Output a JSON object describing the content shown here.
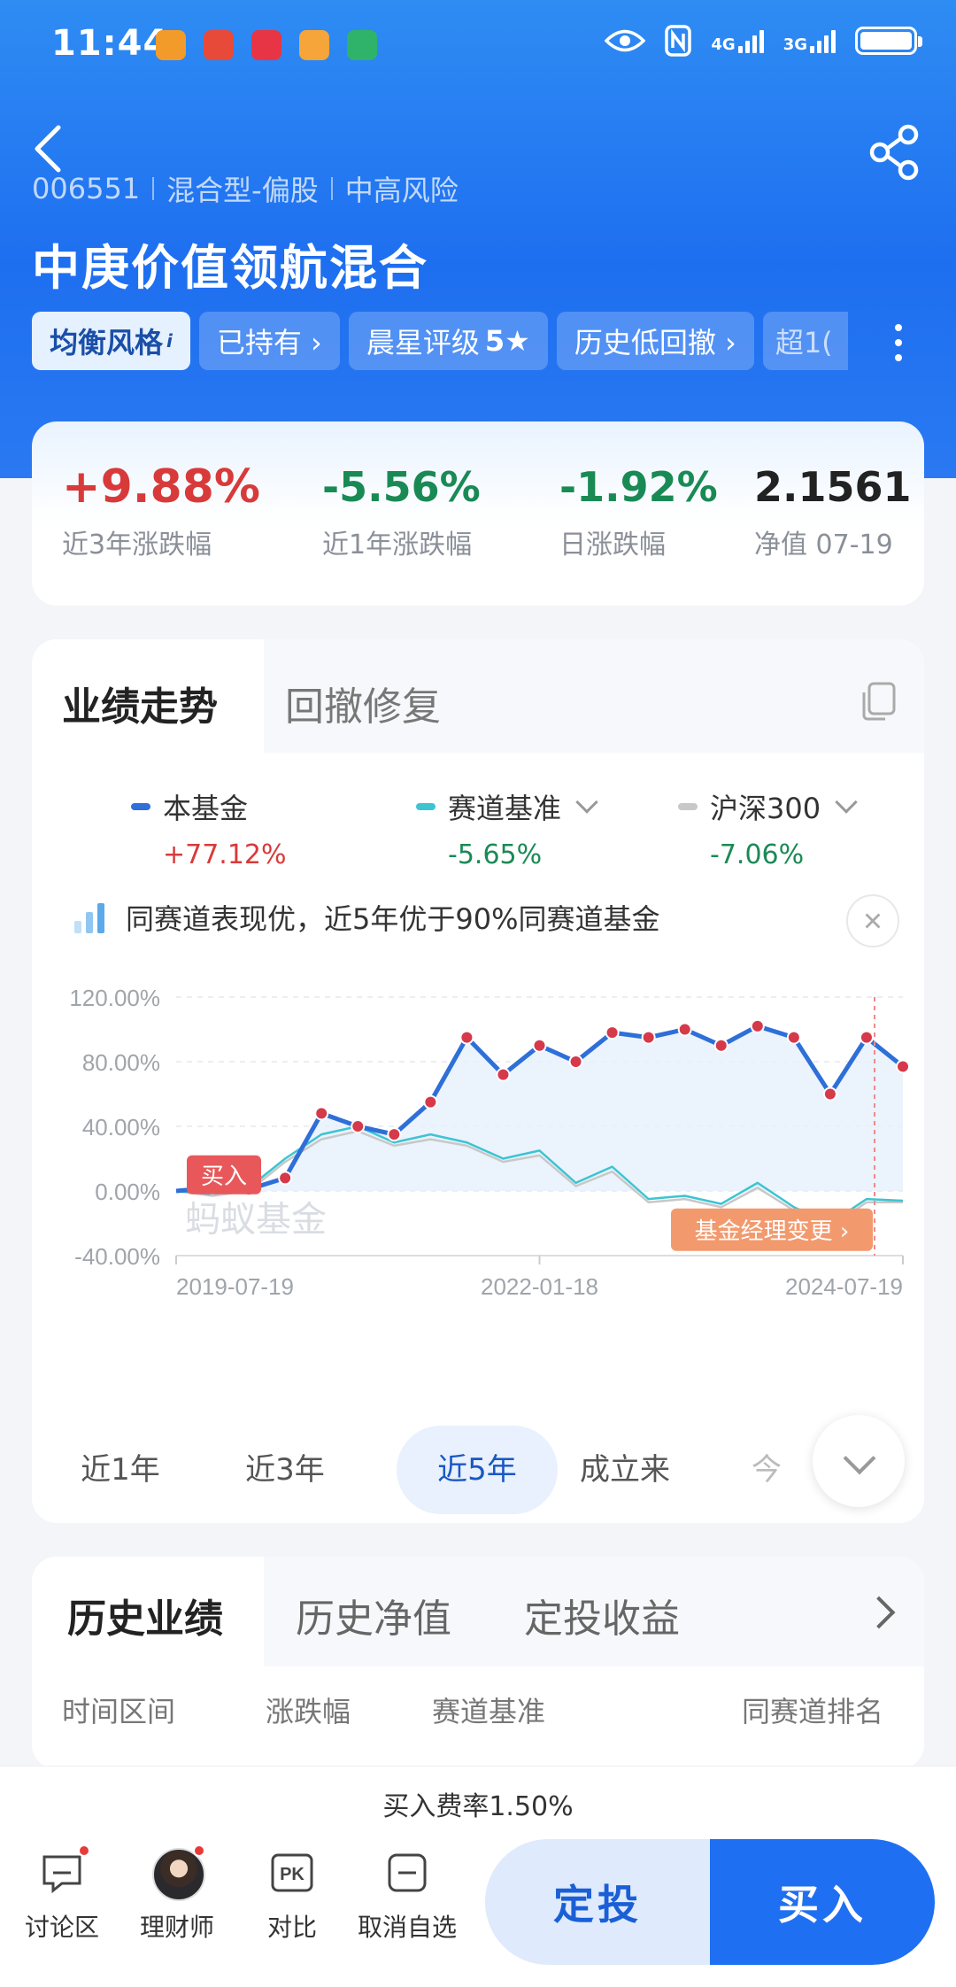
{
  "status_bar": {
    "time": "11:44",
    "network1": "4G",
    "network2": "3G",
    "app_icon_colors": [
      "#f29b2b",
      "#e84a3a",
      "#e83545",
      "#f5a53a",
      "#2fb36a"
    ]
  },
  "header": {
    "fund_code": "006551",
    "fund_type": "混合型-偏股",
    "risk_level": "中高风险",
    "fund_name": "中庚价值领航混合",
    "tags": [
      {
        "label": "均衡风格",
        "suffix": "i"
      },
      {
        "label": "已持有 ›"
      },
      {
        "label": "晨星评级",
        "strong": "5★"
      },
      {
        "label": "历史低回撤 ›"
      },
      {
        "label": "超1("
      }
    ]
  },
  "stats": [
    {
      "value": "+9.88%",
      "label": "近3年涨跌幅"
    },
    {
      "value": "-5.56%",
      "label": "近1年涨跌幅"
    },
    {
      "value": "-1.92%",
      "label": "日涨跌幅"
    },
    {
      "value": "2.1561",
      "label": "净值 07-19"
    }
  ],
  "performance": {
    "tab_active": "业绩走势",
    "tab_inactive": "回撤修复",
    "legend": [
      {
        "name": "本基金",
        "value": "+77.12%",
        "color": "#2e6fd8"
      },
      {
        "name": "赛道基准",
        "value": "-5.65%",
        "color": "#3cc4d2"
      },
      {
        "name": "沪深300",
        "value": "-7.06%",
        "color": "#c8c8c8"
      }
    ],
    "notice": "同赛道表现优，近5年优于90%同赛道基金",
    "buy_marker": "买入",
    "manager_change": "基金经理变更 ›",
    "watermark": "蚂蚁基金",
    "ranges": [
      "近1年",
      "近3年",
      "近5年",
      "成立来",
      "今"
    ],
    "active_range": "近5年"
  },
  "chart_data": {
    "type": "line",
    "yticks": [
      "120.00%",
      "80.00%",
      "40.00%",
      "0.00%",
      "-40.00%"
    ],
    "xticks": [
      "2019-07-19",
      "2022-01-18",
      "2024-07-19"
    ],
    "ylim": [
      -40,
      120
    ],
    "x": [
      "2019-07",
      "2019-10",
      "2020-01",
      "2020-04",
      "2020-07",
      "2020-10",
      "2021-01",
      "2021-04",
      "2021-07",
      "2021-10",
      "2022-01",
      "2022-04",
      "2022-07",
      "2022-10",
      "2023-01",
      "2023-04",
      "2023-07",
      "2023-10",
      "2024-01",
      "2024-04",
      "2024-07"
    ],
    "series": [
      {
        "name": "本基金",
        "values": [
          0,
          2,
          1,
          8,
          48,
          40,
          35,
          55,
          95,
          72,
          90,
          80,
          98,
          95,
          100,
          90,
          102,
          95,
          60,
          95,
          77
        ]
      },
      {
        "name": "赛道基准",
        "values": [
          0,
          -2,
          2,
          20,
          35,
          40,
          30,
          35,
          30,
          20,
          25,
          5,
          15,
          -5,
          -3,
          -8,
          5,
          -10,
          -20,
          -5,
          -6
        ]
      },
      {
        "name": "沪深300",
        "values": [
          0,
          -3,
          0,
          18,
          32,
          37,
          28,
          32,
          28,
          18,
          22,
          3,
          12,
          -7,
          -5,
          -10,
          2,
          -12,
          -22,
          -7,
          -7
        ]
      }
    ]
  },
  "history": {
    "tabs": [
      "历史业绩",
      "历史净值",
      "定投收益"
    ],
    "columns": [
      "时间区间",
      "涨跌幅",
      "赛道基准",
      "同赛道排名"
    ]
  },
  "bottom": {
    "fee": "买入费率1.50%",
    "nav": [
      "讨论区",
      "理财师",
      "对比",
      "取消自选"
    ],
    "sip_button": "定投",
    "buy_button": "买入"
  }
}
